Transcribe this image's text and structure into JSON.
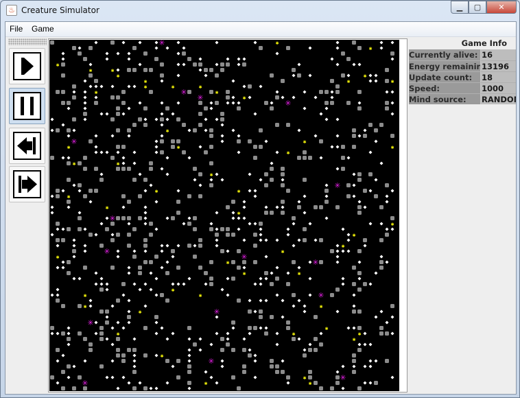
{
  "window": {
    "title": "Creature Simulator"
  },
  "menu": [
    {
      "label": "File"
    },
    {
      "label": "Game"
    }
  ],
  "toolbar": {
    "buttons": [
      {
        "name": "play-button",
        "icon": "play-icon",
        "active": false
      },
      {
        "name": "pause-button",
        "icon": "pause-icon",
        "active": true
      },
      {
        "name": "step-back-button",
        "icon": "step-back-icon",
        "active": false
      },
      {
        "name": "step-forward-button",
        "icon": "step-forward-icon",
        "active": false
      }
    ]
  },
  "info": {
    "title": "Game Info",
    "rows": [
      {
        "key": "Currently alive:",
        "value": "16"
      },
      {
        "key": "Energy remaining:",
        "value": "13196"
      },
      {
        "key": "Update count:",
        "value": "18"
      },
      {
        "key": "Speed:",
        "value": "1000"
      },
      {
        "key": "Mind source:",
        "value": "RANDOM"
      }
    ]
  },
  "board": {
    "background": "#000000",
    "colors": {
      "wall": "#8c8c8c",
      "food": "#ffffff",
      "plant": "#f2f20a",
      "creature": "#e620e6"
    }
  }
}
